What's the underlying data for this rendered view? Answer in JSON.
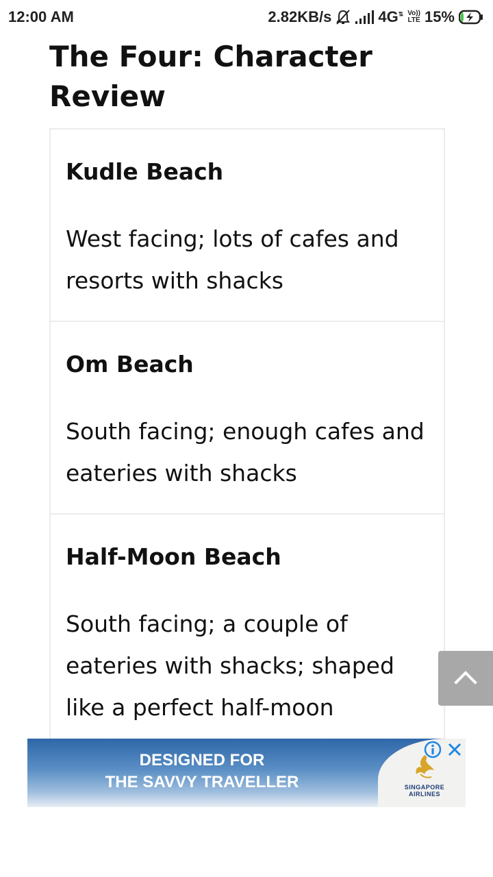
{
  "status_bar": {
    "time": "12:00 AM",
    "data_speed": "2.82KB/s",
    "network": "4G",
    "volte_top": "Vo))",
    "volte_bottom": "LTE",
    "battery_percent": "15%",
    "battery_level": 0.15,
    "battery_charging": true
  },
  "article": {
    "title": "The Four: Character Review",
    "beaches": [
      {
        "name": "Kudle Beach",
        "description": "West facing; lots of cafes and resorts with shacks"
      },
      {
        "name": "Om Beach",
        "description": "South facing; enough cafes and eateries with shacks"
      },
      {
        "name": "Half-Moon Beach",
        "description": "South facing; a couple of eateries with shacks; shaped like a perfect half-moon"
      }
    ]
  },
  "scroll_top": {
    "icon": "chevron-up-icon"
  },
  "ad": {
    "headline_line1": "DESIGNED FOR",
    "headline_line2": "THE SAVVY TRAVELLER",
    "brand_line1": "SINGAPORE",
    "brand_line2": "AIRLINES",
    "info_icon": "info-icon",
    "close_icon": "close-icon",
    "colors": {
      "sky_top": "#2e67a8",
      "sky_bottom": "#e9eef4",
      "logo": "#d8a52a",
      "brand_text": "#1d3c78",
      "choices": "#1e88e5"
    }
  }
}
